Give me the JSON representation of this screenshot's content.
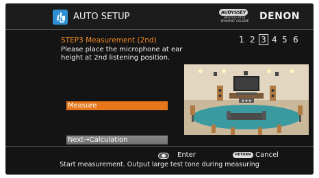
{
  "header": {
    "title": "AUTO SETUP",
    "icon": "auto-setup-icon",
    "audyssey_badge": "AUDYSSEY",
    "audyssey_sub": "MULTEQ XT32 DYNAMIC VOLUME",
    "brand": "DENON"
  },
  "main": {
    "step_title": "STEP3 Measurement (2nd)",
    "instruction": "Please place the microphone at ear height at 2nd listening position.",
    "steps": [
      "1",
      "2",
      "3",
      "4",
      "5",
      "6"
    ],
    "active_step": "3",
    "measure_button": "Measure",
    "next_button": "Next→Calculation"
  },
  "footer": {
    "enter_label": "Enter",
    "return_icon": "RETURN",
    "cancel_label": "Cancel",
    "status": "Start measurement. Output large test tone during measuring"
  },
  "colors": {
    "accent": "#e8771b",
    "step_title": "#f08a24",
    "background": "#141414",
    "room_wall": "#d8c8ad",
    "room_floor": "#3a9aa0"
  }
}
